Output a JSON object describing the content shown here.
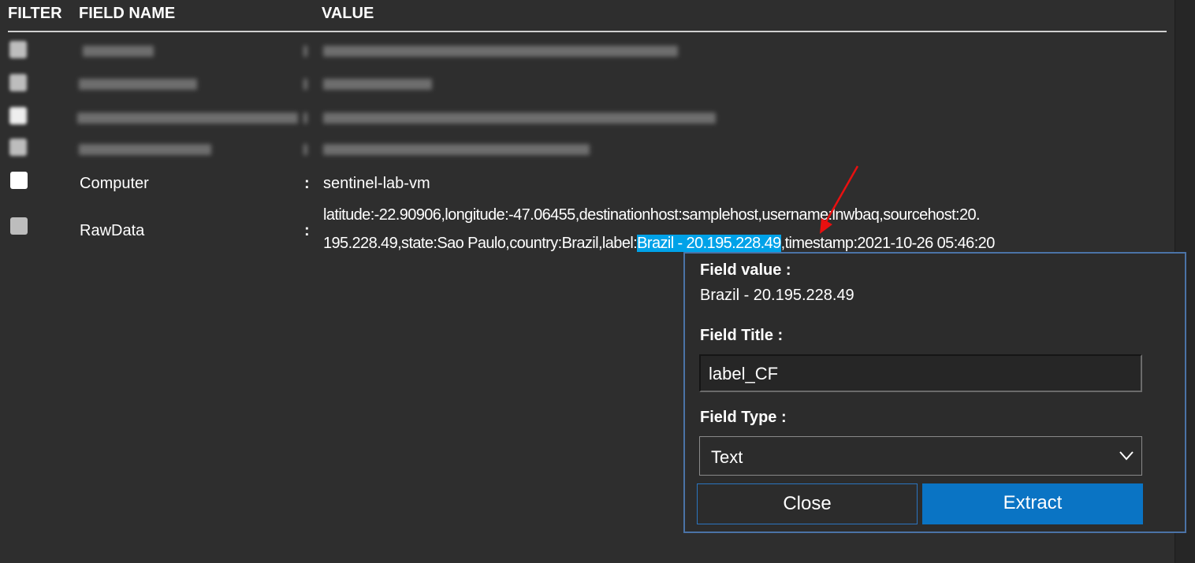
{
  "header": {
    "filter": "FILTER",
    "field_name": "FIELD NAME",
    "value": "VALUE"
  },
  "rows": [
    {
      "field": "Computer",
      "separator": ":",
      "value": "sentinel-lab-vm"
    },
    {
      "field": "RawData",
      "separator": ":",
      "value_line1": "latitude:-22.90906,longitude:-47.06455,destinationhost:samplehost,username:lnwbaq,sourcehost:20.",
      "value_line2_before": "195.228.49,state:Sao Paulo,country:Brazil,label:",
      "value_selected": "Brazil - 20.195.228.49",
      "value_line2_after": ",timestamp:2021-10-26 05:46:20"
    }
  ],
  "popup": {
    "field_value_label": "Field value :",
    "field_value": "Brazil - 20.195.228.49",
    "field_title_label": "Field Title :",
    "field_title_value": "label_CF",
    "field_type_label": "Field Type :",
    "field_type_selected": "Text",
    "close_label": "Close",
    "extract_label": "Extract"
  },
  "colors": {
    "selection": "#00a2e8",
    "extract": "#0a74c4",
    "popup_border": "#4b73a6",
    "arrow": "#e81010"
  }
}
